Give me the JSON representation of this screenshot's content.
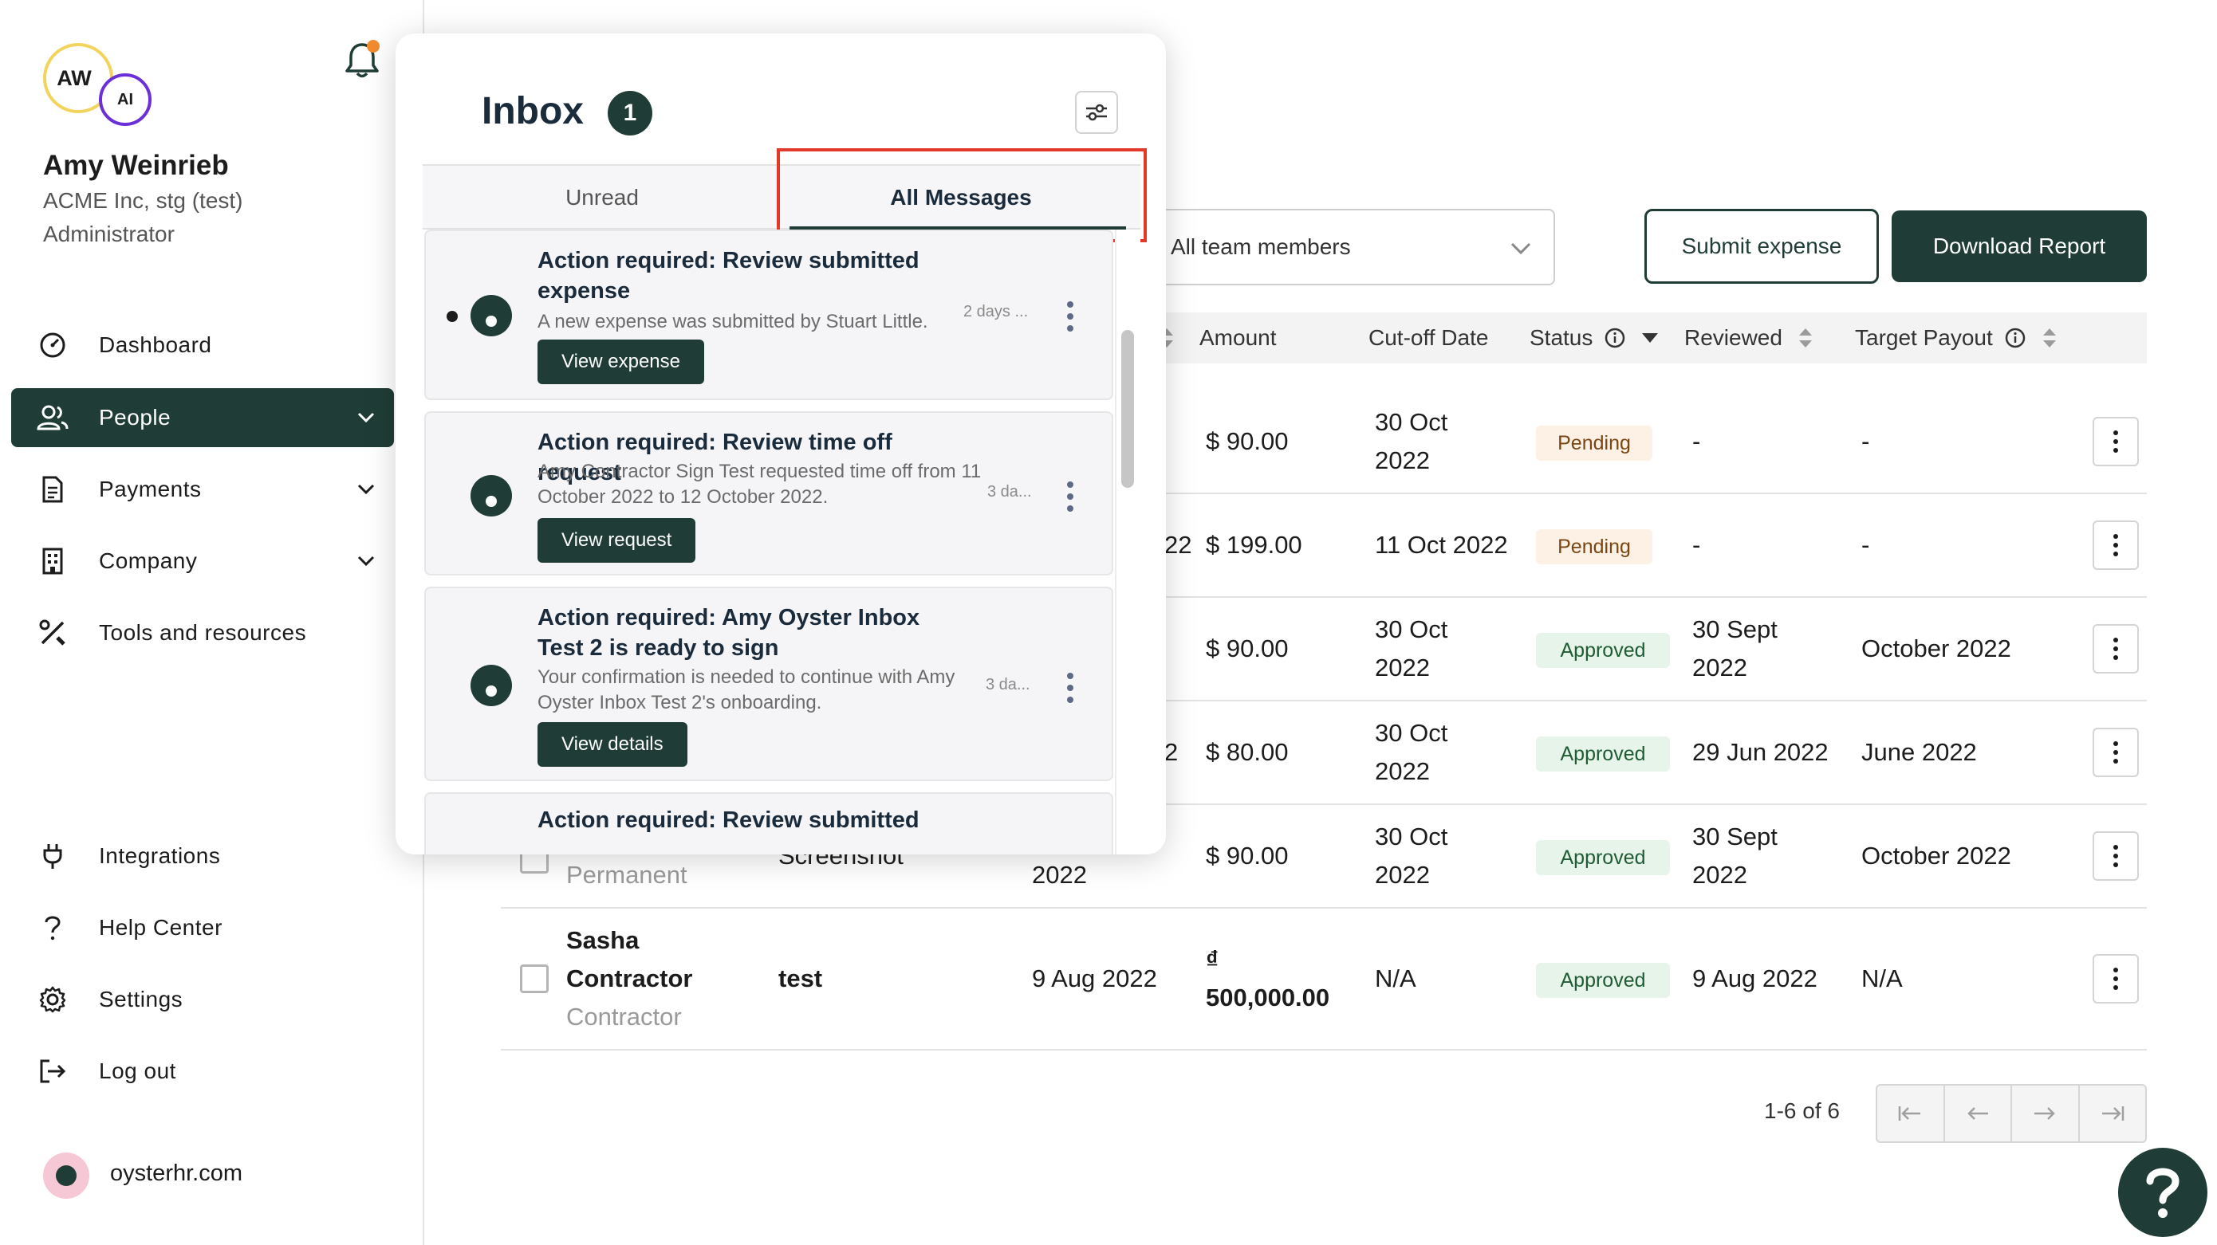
{
  "user": {
    "initials_main": "AW",
    "initials_sub": "AI",
    "name": "Amy Weinrieb",
    "company": "ACME Inc, stg (test)",
    "role": "Administrator"
  },
  "nav": {
    "dashboard": "Dashboard",
    "people": "People",
    "payments": "Payments",
    "company": "Company",
    "tools": "Tools and resources",
    "integrations": "Integrations",
    "help": "Help Center",
    "settings": "Settings",
    "logout": "Log out"
  },
  "footer": {
    "site": "oysterhr.com"
  },
  "filters": {
    "team_select": "All team members"
  },
  "actions": {
    "submit": "Submit expense",
    "download": "Download Report"
  },
  "table": {
    "headers": {
      "amount": "Amount",
      "cutoff": "Cut-off Date",
      "status": "Status",
      "reviewed": "Reviewed",
      "target": "Target Payout"
    },
    "rows": [
      {
        "amount": "$ 90.00",
        "cutoff_1": "30 Oct",
        "cutoff_2": "2022",
        "status": "Pending",
        "reviewed": "-",
        "target": "-"
      },
      {
        "fragment": "22",
        "amount": "$ 199.00",
        "cutoff_1": "11 Oct 2022",
        "status": "Pending",
        "reviewed": "-",
        "target": "-"
      },
      {
        "amount": "$ 90.00",
        "cutoff_1": "30 Oct",
        "cutoff_2": "2022",
        "status": "Approved",
        "reviewed_1": "30 Sept",
        "reviewed_2": "2022",
        "target": "October 2022"
      },
      {
        "fragment": "2",
        "amount": "$ 80.00",
        "cutoff_1": "30 Oct",
        "cutoff_2": "2022",
        "status": "Approved",
        "reviewed": "29 Jun 2022",
        "target": "June 2022"
      },
      {
        "type": "Permanent",
        "desc": "Screenshot",
        "date": "2022",
        "amount": "$ 90.00",
        "cutoff_1": "30 Oct",
        "cutoff_2": "2022",
        "status": "Approved",
        "reviewed_1": "30 Sept",
        "reviewed_2": "2022",
        "target": "October 2022"
      },
      {
        "name_1": "Sasha",
        "name_2": "Contractor",
        "type": "Contractor",
        "desc": "test",
        "date": "9 Aug 2022",
        "amount_1": "₫",
        "amount_2": "500,000.00",
        "cutoff_1": "N/A",
        "status": "Approved",
        "reviewed": "9 Aug 2022",
        "target": "N/A"
      }
    ]
  },
  "pagination": {
    "text": "1-6 of 6"
  },
  "inbox": {
    "title": "Inbox",
    "count": "1",
    "tabs": {
      "unread": "Unread",
      "all": "All Messages"
    },
    "messages": [
      {
        "title": "Action required: Review submitted expense",
        "body": "A new expense was submitted by Stuart Little.",
        "time": "2 days ...",
        "action": "View expense"
      },
      {
        "title": "Action required: Review time off request",
        "body": "Amy Contractor Sign Test requested time off from 11 October 2022 to 12 October 2022.",
        "time": "3 da...",
        "action": "View request"
      },
      {
        "title": "Action required: Amy Oyster Inbox Test 2 is ready to sign",
        "body": "Your confirmation is needed to continue with Amy Oyster Inbox Test 2's onboarding.",
        "time": "3 da...",
        "action": "View details"
      },
      {
        "title": "Action required: Review submitted"
      }
    ]
  },
  "colors": {
    "brand": "#1f3d36",
    "highlight": "#e23a2a",
    "pending_bg": "#fdf0e4",
    "approved_bg": "#e6f4e9"
  }
}
